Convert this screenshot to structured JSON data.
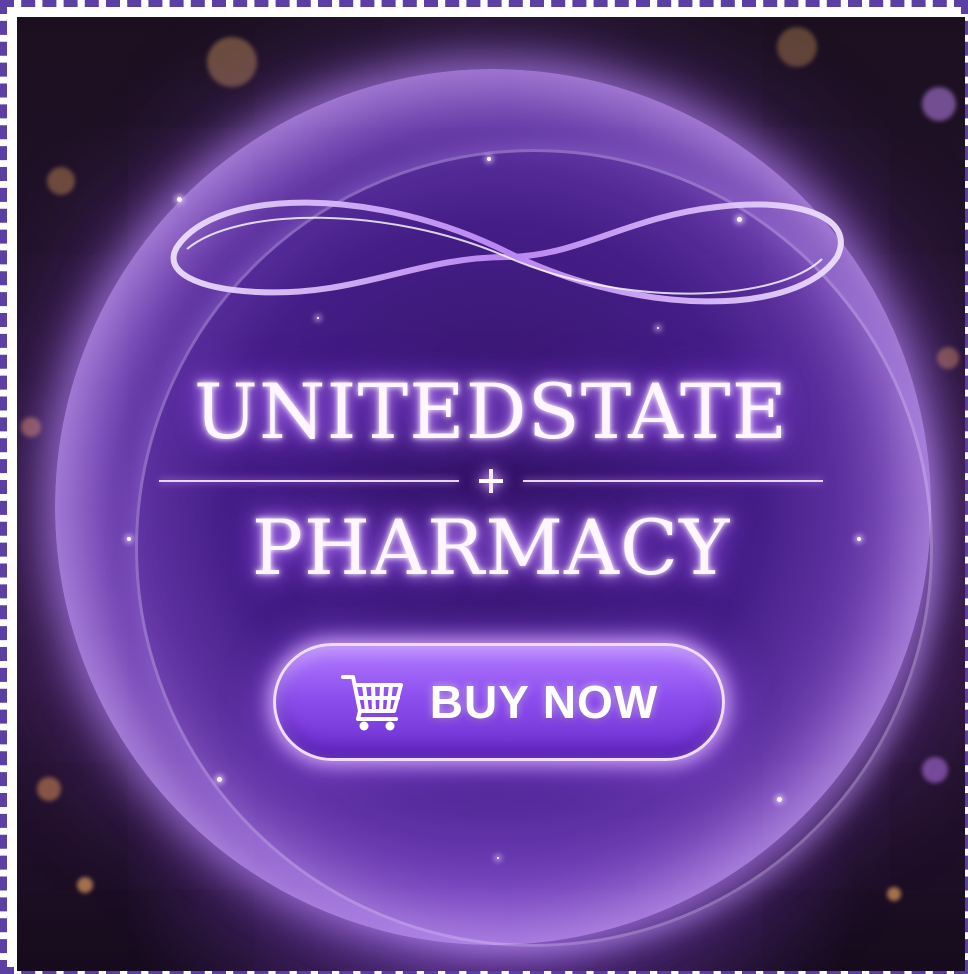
{
  "banner": {
    "title_line1": "UNITEDSTATE",
    "title_line2": "PHARMACY",
    "divider_icon": "plus-icon",
    "cta": {
      "label": "BUY NOW",
      "icon": "shopping-cart-icon"
    }
  },
  "colors": {
    "border": "#5b3fa5",
    "orb_purple": "#7a3fd8",
    "glow": "#a865ff",
    "text": "#fff6ff",
    "button_top": "#b27aff",
    "button_bottom": "#6d2fd0"
  }
}
